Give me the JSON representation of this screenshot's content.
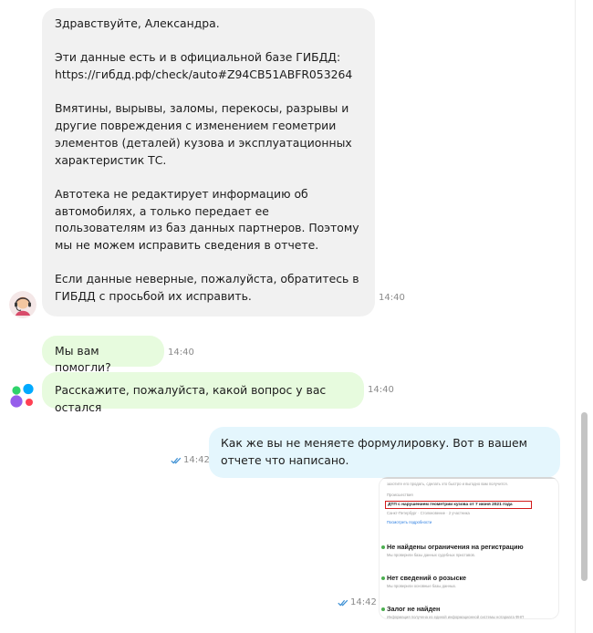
{
  "messages": [
    {
      "id": "operator-reply",
      "paragraphs": [
        "Здравствуйте, Александра.",
        "Эти данные есть и в официальной базе ГИБДД: https://гибдд.рф/check/auto#Z94CB51ABFR053264",
        "Вмятины, вырывы, заломы, перекосы, разрывы и другие повреждения с изменением геометрии элементов (деталей) кузова и эксплуатационных характеристик ТС.",
        "Автотека не редактирует информацию об автомобилях, а только передает ее пользователям из баз данных партнеров. Поэтому мы не можем исправить сведения в отчете.",
        "Если данные неверные, пожалуйста, обратитесь в ГИБДД с просьбой их исправить."
      ],
      "time": "14:40"
    },
    {
      "id": "bot-question",
      "text": "Мы вам помогли?",
      "time": "14:40"
    },
    {
      "id": "bot-prompt",
      "text": "Расскажите, пожалуйста, какой вопрос у вас остался",
      "time": "14:40"
    },
    {
      "id": "user-reply",
      "text": "Как же вы не меняете формулировку. Вот в вашем отчете что написано.",
      "time": "14:42"
    },
    {
      "id": "user-screenshot",
      "time": "14:42",
      "screenshot": {
        "intro_text": "захотите его продать, сделать это быстро и выгодно вам получится.",
        "incidents_label": "Происшествия",
        "highlighted_incident": "ДТП с нарушением геометрии кузова от 7 июня 2021 года",
        "incident_meta": "Санкт-Петербург · Столкновение · 2 участника",
        "details_link": "Посмотреть подробности",
        "checks": [
          {
            "title": "Не найдены ограничения на регистрацию",
            "note": "Мы проверили базы данных судебных приставов."
          },
          {
            "title": "Нет сведений о розыске",
            "note": "Мы проверили основные базы данных."
          },
          {
            "title": "Залог не найден",
            "note": "Информация получена из единой информационной системы нотариата ФНП"
          }
        ]
      }
    }
  ],
  "colors": {
    "operator_bubble": "#f1f1f1",
    "bot_bubble": "#e7fbde",
    "user_bubble": "#e4f6fd",
    "read_ticks": "#3b8fd4",
    "highlight_border": "#d21a1a",
    "check_dot": "#4caf50"
  },
  "icons": {
    "operator_avatar": "support-agent-avatar-icon",
    "bot_avatar": "colored-dots-bot-icon",
    "read_receipt": "double-check-icon"
  }
}
